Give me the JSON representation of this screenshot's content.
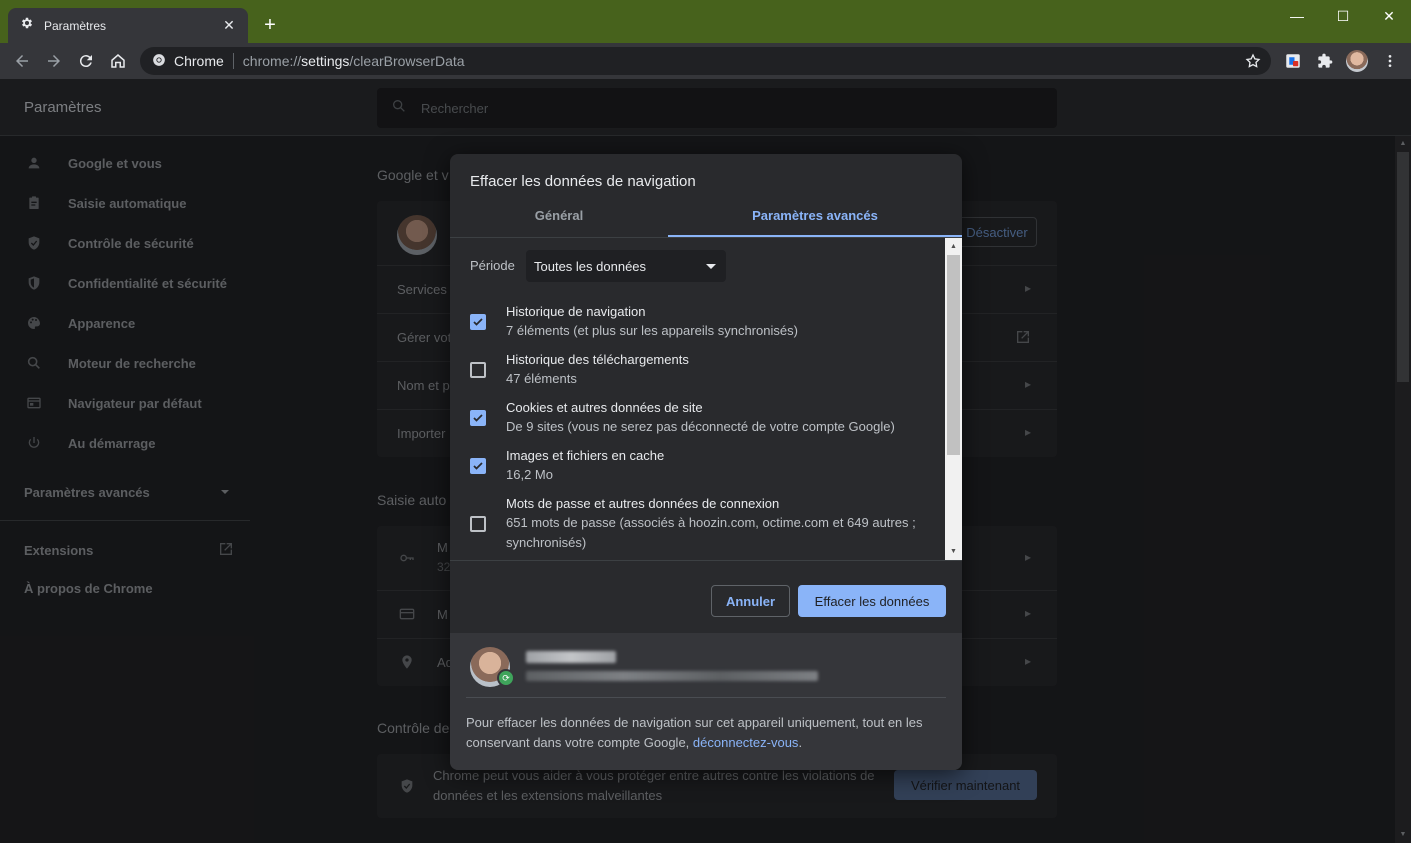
{
  "browser": {
    "tab_title": "Paramètres",
    "omnibox_site": "Chrome",
    "url_scheme": "chrome://",
    "url_host": "settings",
    "url_path": "/clearBrowserData"
  },
  "settings": {
    "header_title": "Paramètres",
    "search_placeholder": "Rechercher",
    "sidebar": {
      "items": [
        {
          "label": "Google et vous",
          "icon": "person-icon"
        },
        {
          "label": "Saisie automatique",
          "icon": "clipboard-icon"
        },
        {
          "label": "Contrôle de sécurité",
          "icon": "shield-check-icon"
        },
        {
          "label": "Confidentialité et sécurité",
          "icon": "shield-half-icon"
        },
        {
          "label": "Apparence",
          "icon": "palette-icon"
        },
        {
          "label": "Moteur de recherche",
          "icon": "search-icon"
        },
        {
          "label": "Navigateur par défaut",
          "icon": "browser-window-icon"
        },
        {
          "label": "Au démarrage",
          "icon": "power-icon"
        }
      ],
      "advanced": "Paramètres avancés",
      "extensions": "Extensions",
      "about": "À propos de Chrome"
    },
    "background": {
      "section_google": "Google et v",
      "btn_deactivate": "Désactiver",
      "row_services": "Services",
      "row_manage": "Gérer vot",
      "row_name": "Nom et p",
      "row_import": "Importer",
      "section_autofill": "Saisie auto",
      "autofill_row1": "M",
      "autofill_row1_sub": "32",
      "autofill_row2": "M",
      "autofill_row3": "Ad",
      "section_security": "Contrôle de",
      "security_text_1": "Chrome peut vous aider à vous protéger entre autres contre les violations de",
      "security_text_2": "données et les extensions malveillantes",
      "btn_verify": "Vérifier maintenant"
    }
  },
  "dialog": {
    "title": "Effacer les données de navigation",
    "tab_general": "Général",
    "tab_advanced": "Paramètres avancés",
    "period_label": "Période",
    "period_value": "Toutes les données",
    "options": [
      {
        "title": "Historique de navigation",
        "sub": "7 éléments (et plus sur les appareils synchronisés)",
        "checked": true
      },
      {
        "title": "Historique des téléchargements",
        "sub": "47 éléments",
        "checked": false
      },
      {
        "title": "Cookies et autres données de site",
        "sub": "De 9 sites (vous ne serez pas déconnecté de votre compte Google)",
        "checked": true
      },
      {
        "title": "Images et fichiers en cache",
        "sub": "16,2 Mo",
        "checked": true
      },
      {
        "title": "Mots de passe et autres données de connexion",
        "sub": "651 mots de passe (associés à hoozin.com, octime.com et 649 autres ; synchronisés)",
        "checked": false
      }
    ],
    "btn_cancel": "Annuler",
    "btn_clear": "Effacer les données",
    "footer_text": "Pour effacer les données de navigation sur cet appareil uniquement, tout en les conservant dans votre compte Google,",
    "footer_link": "déconnectez-vous",
    "footer_end": "."
  },
  "colors": {
    "frame": "#47621c",
    "accent": "#8ab4f8",
    "dialog_bg": "#292a2d"
  }
}
